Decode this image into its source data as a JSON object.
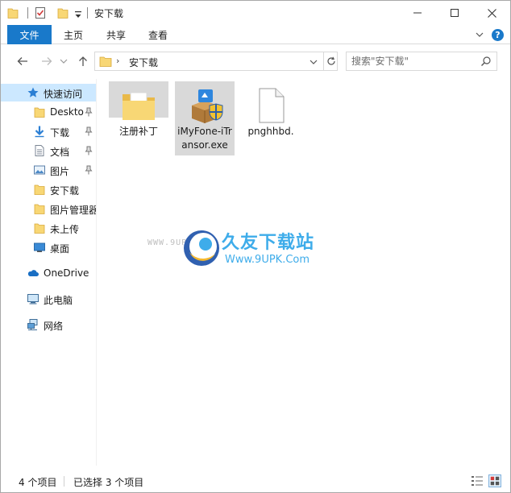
{
  "window": {
    "title": "安下载",
    "minimize_glyph": "—",
    "maximize_glyph": "☐",
    "close_glyph": "✕"
  },
  "ribbon": {
    "file_tab": "文件",
    "tabs": [
      "主页",
      "共享",
      "查看"
    ],
    "help": "?"
  },
  "address": {
    "path": "安下载",
    "separator": "›"
  },
  "search": {
    "placeholder": "搜索\"安下载\""
  },
  "sidebar": {
    "items": [
      {
        "label": "快速访问",
        "icon": "star-icon",
        "active": true
      },
      {
        "label": "Desktop",
        "icon": "folder-icon",
        "pinned": true
      },
      {
        "label": "下载",
        "icon": "download-icon",
        "pinned": true
      },
      {
        "label": "文档",
        "icon": "document-icon",
        "pinned": true
      },
      {
        "label": "图片",
        "icon": "picture-icon",
        "pinned": true
      },
      {
        "label": "安下载",
        "icon": "folder-icon"
      },
      {
        "label": "图片管理器",
        "icon": "folder-icon"
      },
      {
        "label": "未上传",
        "icon": "folder-icon"
      },
      {
        "label": "桌面",
        "icon": "desktop-icon"
      },
      {
        "label": "OneDrive",
        "icon": "cloud-icon"
      },
      {
        "label": "此电脑",
        "icon": "computer-icon"
      },
      {
        "label": "网络",
        "icon": "network-icon"
      }
    ]
  },
  "files": [
    {
      "name": "注册补丁",
      "icon": "folder-icon",
      "selected": true
    },
    {
      "name": "iMyFone-iTransor.exe",
      "icon": "installer-icon",
      "selected": true
    },
    {
      "name": "pnghhbd.",
      "icon": "blank-file-icon",
      "selected": false
    }
  ],
  "watermark": {
    "small_text": "WWW.9UPK.COM",
    "brand": "久友下载站",
    "url": "Www.9UPK.Com"
  },
  "status": {
    "item_count": "4 个项目",
    "selection": "已选择 3 个项目"
  },
  "colors": {
    "accent": "#1979ca",
    "selection": "#cce8ff",
    "folder": "#f8d775"
  }
}
